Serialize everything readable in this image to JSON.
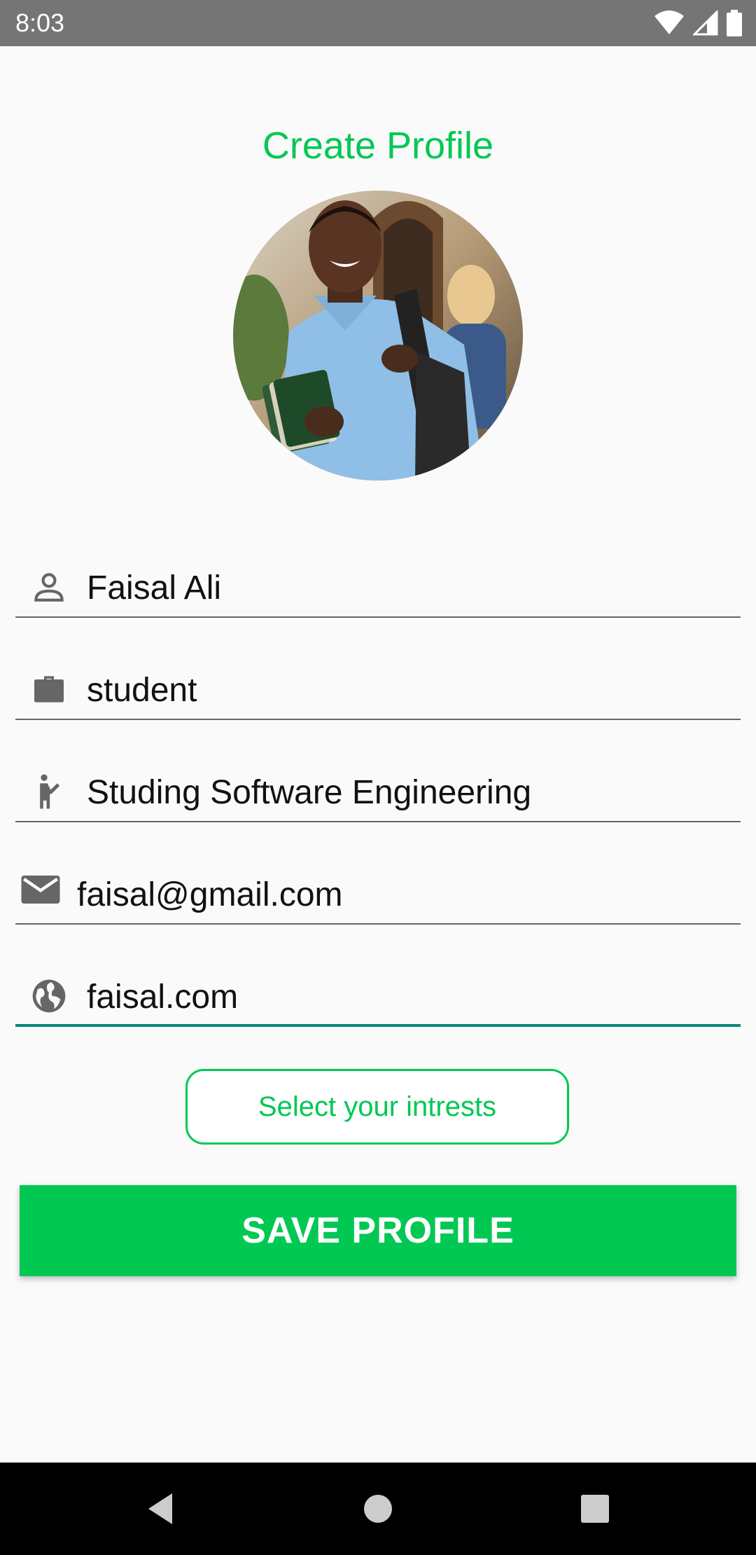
{
  "status_bar": {
    "time": "8:03",
    "icons": [
      "wifi-icon",
      "signal-icon",
      "battery-icon"
    ]
  },
  "header": {
    "title": "Create Profile"
  },
  "avatar": {
    "alt": "profile photo"
  },
  "form": {
    "fields": [
      {
        "icon": "person-icon",
        "value": "Faisal Ali"
      },
      {
        "icon": "briefcase-icon",
        "value": "student"
      },
      {
        "icon": "activity-icon",
        "value": "Studing Software Engineering"
      },
      {
        "icon": "email-icon",
        "value": "faisal@gmail.com"
      },
      {
        "icon": "globe-icon",
        "value": "faisal.com"
      }
    ]
  },
  "buttons": {
    "interests_label": "Select your intrests",
    "save_label": "SAVE PROFILE"
  },
  "colors": {
    "accent": "#00c853",
    "focused_underline": "#00897b",
    "status_bar": "#757575",
    "nav_bar": "#000000"
  },
  "nav_bar": {
    "icons": [
      "back-icon",
      "home-icon",
      "recents-icon"
    ]
  }
}
